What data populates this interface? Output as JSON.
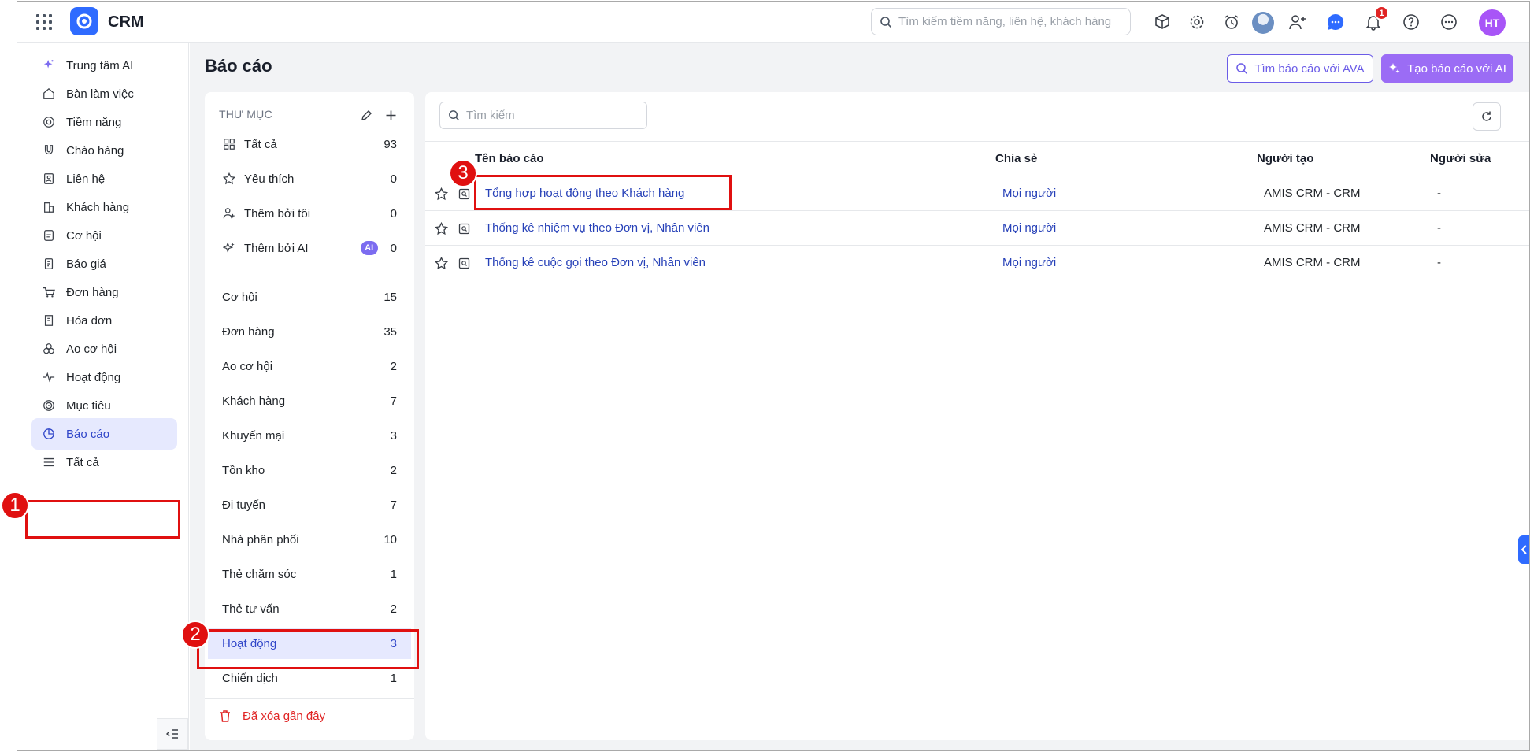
{
  "topbar": {
    "brand": "CRM",
    "search_placeholder": "Tìm kiếm tiềm năng, liên hệ, khách hàng",
    "notification_count": "1",
    "user_initials": "HT"
  },
  "leftnav": {
    "items": [
      {
        "label": "Trung tâm AI",
        "icon": "sparkle-icon"
      },
      {
        "label": "Bàn làm việc",
        "icon": "home-icon"
      },
      {
        "label": "Tiềm năng",
        "icon": "target-icon"
      },
      {
        "label": "Chào hàng",
        "icon": "magnet-icon"
      },
      {
        "label": "Liên hệ",
        "icon": "contact-card-icon"
      },
      {
        "label": "Khách hàng",
        "icon": "building-icon"
      },
      {
        "label": "Cơ hội",
        "icon": "opportunity-icon"
      },
      {
        "label": "Báo giá",
        "icon": "quote-icon"
      },
      {
        "label": "Đơn hàng",
        "icon": "cart-icon"
      },
      {
        "label": "Hóa đơn",
        "icon": "invoice-icon"
      },
      {
        "label": "Ao cơ hội",
        "icon": "pool-icon"
      },
      {
        "label": "Hoạt động",
        "icon": "activity-icon"
      },
      {
        "label": "Mục tiêu",
        "icon": "goal-icon"
      },
      {
        "label": "Báo cáo",
        "icon": "pie-chart-icon",
        "active": true
      },
      {
        "label": "Tất cả",
        "icon": "menu-icon"
      }
    ]
  },
  "page": {
    "title": "Báo cáo",
    "ava_button": "Tìm báo cáo với AVA",
    "ai_button": "Tạo báo cáo với AI"
  },
  "folders": {
    "header": "THƯ MỤC",
    "top_items": [
      {
        "label": "Tất cả",
        "count": "93",
        "icon": "grid-icon"
      },
      {
        "label": "Yêu thích",
        "count": "0",
        "icon": "star-icon"
      },
      {
        "label": "Thêm bởi tôi",
        "count": "0",
        "icon": "user-add-icon"
      },
      {
        "label": "Thêm bởi AI",
        "count": "0",
        "icon": "ai-sparkle-icon",
        "chip": "AI"
      }
    ],
    "module_items": [
      {
        "label": "Cơ hội",
        "count": "15"
      },
      {
        "label": "Đơn hàng",
        "count": "35"
      },
      {
        "label": "Ao cơ hội",
        "count": "2"
      },
      {
        "label": "Khách hàng",
        "count": "7"
      },
      {
        "label": "Khuyến mại",
        "count": "3"
      },
      {
        "label": "Tồn kho",
        "count": "2"
      },
      {
        "label": "Đi tuyến",
        "count": "7"
      },
      {
        "label": "Nhà phân phối",
        "count": "10"
      },
      {
        "label": "Thẻ chăm sóc",
        "count": "1"
      },
      {
        "label": "Thẻ tư vấn",
        "count": "2"
      },
      {
        "label": "Hoạt động",
        "count": "3",
        "active": true
      },
      {
        "label": "Chiến dịch",
        "count": "1"
      }
    ],
    "deleted_label": "Đã xóa gần đây"
  },
  "reports": {
    "search_placeholder": "Tìm kiếm",
    "columns": {
      "name": "Tên báo cáo",
      "share": "Chia sẻ",
      "creator": "Người tạo",
      "editor": "Người sửa"
    },
    "rows": [
      {
        "name": "Tổng hợp hoạt động theo Khách hàng",
        "share": "Mọi người",
        "creator": "AMIS CRM - CRM",
        "editor": "-"
      },
      {
        "name": "Thống kê nhiệm vụ theo Đơn vị, Nhân viên",
        "share": "Mọi người",
        "creator": "AMIS CRM - CRM",
        "editor": "-"
      },
      {
        "name": "Thống kê cuộc gọi theo Đơn vị, Nhân viên",
        "share": "Mọi người",
        "creator": "AMIS CRM - CRM",
        "editor": "-"
      }
    ]
  },
  "annotations": {
    "markers": [
      "1",
      "2",
      "3"
    ],
    "color": "#e01010"
  },
  "colors": {
    "accent": "#3046c9",
    "link": "#2741b8",
    "ai_purple": "#9b6cf5",
    "danger": "#e02424",
    "active_bg": "#e6e9fe"
  }
}
